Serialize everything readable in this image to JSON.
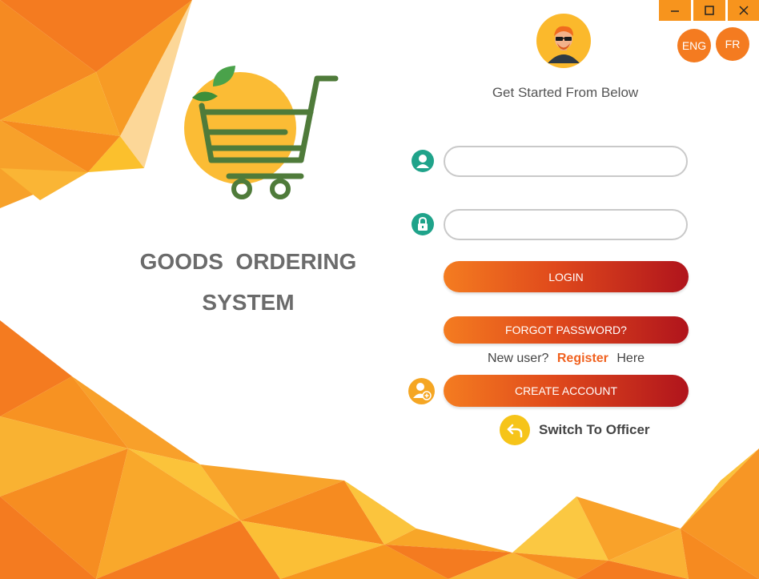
{
  "window": {
    "controls": {
      "minimize_icon": "minimize-icon",
      "maximize_icon": "maximize-icon",
      "close_icon": "close-icon"
    }
  },
  "language": {
    "eng_label": "ENG",
    "fr_label": "FR"
  },
  "brand": {
    "title_line1": "GOODS  ORDERING",
    "title_line2": "SYSTEM",
    "logo_icon": "shopping-cart-leaf-icon"
  },
  "login": {
    "subtitle": "Get Started From Below",
    "username_icon": "user-icon",
    "password_icon": "lock-icon",
    "username_value": "",
    "password_value": "",
    "login_label": "LOGIN",
    "forgot_label": "FORGOT PASSWORD?",
    "new_user_text": "New user?",
    "register_text": "Register",
    "here_text": "Here",
    "create_label": "CREATE ACCOUNT",
    "create_icon": "add-user-icon",
    "switch_label": "Switch To Officer",
    "switch_icon": "undo-arrow-icon"
  },
  "colors": {
    "accent_orange": "#f47b20",
    "button_end": "#b0141c",
    "field_icon": "#1fa38a",
    "register": "#f0611f",
    "title_gray": "#6b6b6b"
  }
}
